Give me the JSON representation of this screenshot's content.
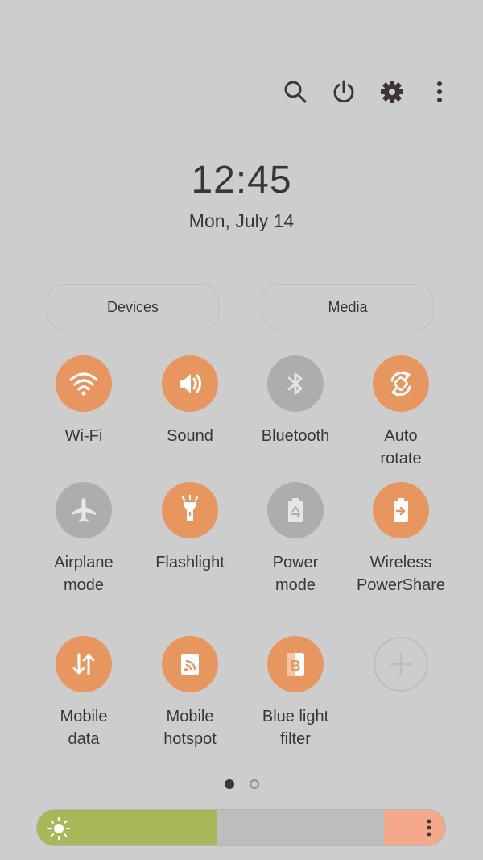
{
  "top_bar": {
    "icons": [
      "search-icon",
      "power-icon",
      "gear-icon",
      "more-vertical-icon"
    ]
  },
  "clock": {
    "time": "12:45",
    "date": "Mon, July 14"
  },
  "shortcuts": {
    "devices_label": "Devices",
    "media_label": "Media"
  },
  "tiles": [
    {
      "label": "Wi-Fi",
      "icon": "wifi-icon",
      "state": "on"
    },
    {
      "label": "Sound",
      "icon": "volume-icon",
      "state": "on"
    },
    {
      "label": "Bluetooth",
      "icon": "bluetooth-icon",
      "state": "off"
    },
    {
      "label": "Auto\nrotate",
      "icon": "auto-rotate-icon",
      "state": "on"
    },
    {
      "label": "Airplane\nmode",
      "icon": "airplane-icon",
      "state": "off"
    },
    {
      "label": "Flashlight",
      "icon": "flashlight-icon",
      "state": "on"
    },
    {
      "label": "Power\nmode",
      "icon": "battery-recycle-icon",
      "state": "off"
    },
    {
      "label": "Wireless\nPowerShare",
      "icon": "battery-share-icon",
      "state": "on"
    },
    {
      "label": "Mobile\ndata",
      "icon": "data-arrows-icon",
      "state": "on"
    },
    {
      "label": "Mobile\nhotspot",
      "icon": "hotspot-icon",
      "state": "on"
    },
    {
      "label": "Blue light\nfilter",
      "icon": "blue-light-filter-icon",
      "state": "on"
    },
    {
      "label": "",
      "icon": "add-icon",
      "state": "add"
    }
  ],
  "pager": {
    "pages": 2,
    "current": 1
  },
  "brightness": {
    "level": 0.44,
    "icon": "sun-icon",
    "menu_icon": "more-vertical-icon"
  },
  "colors": {
    "background": "#cdcdcd",
    "tile_on": "#e89660",
    "tile_off": "#adadad",
    "brightness_fill": "#a9b75b",
    "brightness_end": "#f3a98a",
    "text": "#3b3536"
  }
}
